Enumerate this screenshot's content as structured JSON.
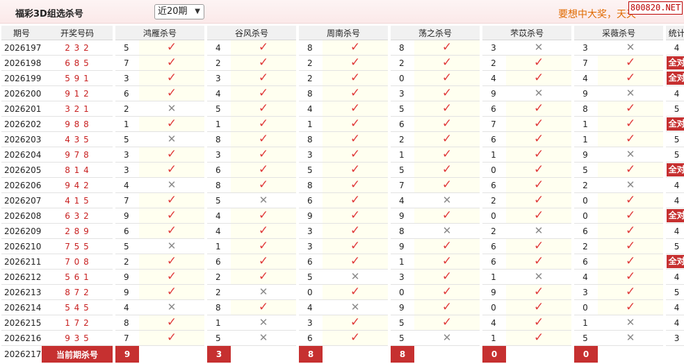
{
  "header": {
    "title": "福彩3D组选杀号",
    "period_select": "近20期",
    "slogan": "要想中大奖，天天",
    "watermark": "800820.NET"
  },
  "table": {
    "headers": {
      "issue": "期号",
      "draw": "开奖号码",
      "experts": [
        "鸿雁杀号",
        "谷风杀号",
        "周南杀号",
        "荡之杀号",
        "芣苡杀号",
        "采薇杀号"
      ],
      "stats": "统计"
    },
    "rows": [
      {
        "issue": "2026197",
        "draw": "2 3 2",
        "kills": [
          [
            5,
            1
          ],
          [
            4,
            1
          ],
          [
            8,
            1
          ],
          [
            8,
            1
          ],
          [
            3,
            0
          ],
          [
            3,
            0
          ]
        ],
        "stat": "4"
      },
      {
        "issue": "2026198",
        "draw": "6 8 5",
        "kills": [
          [
            7,
            1
          ],
          [
            2,
            1
          ],
          [
            2,
            1
          ],
          [
            2,
            1
          ],
          [
            2,
            1
          ],
          [
            7,
            1
          ]
        ],
        "stat": "全对"
      },
      {
        "issue": "2026199",
        "draw": "5 9 1",
        "kills": [
          [
            3,
            1
          ],
          [
            3,
            1
          ],
          [
            2,
            1
          ],
          [
            0,
            1
          ],
          [
            4,
            1
          ],
          [
            4,
            1
          ]
        ],
        "stat": "全对"
      },
      {
        "issue": "2026200",
        "draw": "9 1 2",
        "kills": [
          [
            6,
            1
          ],
          [
            4,
            1
          ],
          [
            8,
            1
          ],
          [
            3,
            1
          ],
          [
            9,
            0
          ],
          [
            9,
            0
          ]
        ],
        "stat": "4"
      },
      {
        "issue": "2026201",
        "draw": "3 2 1",
        "kills": [
          [
            2,
            0
          ],
          [
            5,
            1
          ],
          [
            4,
            1
          ],
          [
            5,
            1
          ],
          [
            6,
            1
          ],
          [
            8,
            1
          ]
        ],
        "stat": "5"
      },
      {
        "issue": "2026202",
        "draw": "9 8 8",
        "kills": [
          [
            1,
            1
          ],
          [
            1,
            1
          ],
          [
            1,
            1
          ],
          [
            6,
            1
          ],
          [
            7,
            1
          ],
          [
            1,
            1
          ]
        ],
        "stat": "全对"
      },
      {
        "issue": "2026203",
        "draw": "4 3 5",
        "kills": [
          [
            5,
            0
          ],
          [
            8,
            1
          ],
          [
            8,
            1
          ],
          [
            2,
            1
          ],
          [
            6,
            1
          ],
          [
            1,
            1
          ]
        ],
        "stat": "5"
      },
      {
        "issue": "2026204",
        "draw": "9 7 8",
        "kills": [
          [
            3,
            1
          ],
          [
            3,
            1
          ],
          [
            3,
            1
          ],
          [
            1,
            1
          ],
          [
            1,
            1
          ],
          [
            9,
            0
          ]
        ],
        "stat": "5"
      },
      {
        "issue": "2026205",
        "draw": "8 1 4",
        "kills": [
          [
            3,
            1
          ],
          [
            6,
            1
          ],
          [
            5,
            1
          ],
          [
            5,
            1
          ],
          [
            0,
            1
          ],
          [
            5,
            1
          ]
        ],
        "stat": "全对"
      },
      {
        "issue": "2026206",
        "draw": "9 4 2",
        "kills": [
          [
            4,
            0
          ],
          [
            8,
            1
          ],
          [
            8,
            1
          ],
          [
            7,
            1
          ],
          [
            6,
            1
          ],
          [
            2,
            0
          ]
        ],
        "stat": "4"
      },
      {
        "issue": "2026207",
        "draw": "4 1 5",
        "kills": [
          [
            7,
            1
          ],
          [
            5,
            0
          ],
          [
            6,
            1
          ],
          [
            4,
            0
          ],
          [
            2,
            1
          ],
          [
            0,
            1
          ]
        ],
        "stat": "4"
      },
      {
        "issue": "2026208",
        "draw": "6 3 2",
        "kills": [
          [
            9,
            1
          ],
          [
            4,
            1
          ],
          [
            9,
            1
          ],
          [
            9,
            1
          ],
          [
            0,
            1
          ],
          [
            0,
            1
          ]
        ],
        "stat": "全对"
      },
      {
        "issue": "2026209",
        "draw": "2 8 9",
        "kills": [
          [
            6,
            1
          ],
          [
            4,
            1
          ],
          [
            3,
            1
          ],
          [
            8,
            0
          ],
          [
            2,
            0
          ],
          [
            6,
            1
          ]
        ],
        "stat": "4"
      },
      {
        "issue": "2026210",
        "draw": "7 5 5",
        "kills": [
          [
            5,
            0
          ],
          [
            1,
            1
          ],
          [
            3,
            1
          ],
          [
            9,
            1
          ],
          [
            6,
            1
          ],
          [
            2,
            1
          ]
        ],
        "stat": "5"
      },
      {
        "issue": "2026211",
        "draw": "7 0 8",
        "kills": [
          [
            2,
            1
          ],
          [
            6,
            1
          ],
          [
            6,
            1
          ],
          [
            1,
            1
          ],
          [
            6,
            1
          ],
          [
            6,
            1
          ]
        ],
        "stat": "全对"
      },
      {
        "issue": "2026212",
        "draw": "5 6 1",
        "kills": [
          [
            9,
            1
          ],
          [
            2,
            1
          ],
          [
            5,
            0
          ],
          [
            3,
            1
          ],
          [
            1,
            0
          ],
          [
            4,
            1
          ]
        ],
        "stat": "4"
      },
      {
        "issue": "2026213",
        "draw": "8 7 2",
        "kills": [
          [
            9,
            1
          ],
          [
            2,
            0
          ],
          [
            0,
            1
          ],
          [
            0,
            1
          ],
          [
            9,
            1
          ],
          [
            3,
            1
          ]
        ],
        "stat": "5"
      },
      {
        "issue": "2026214",
        "draw": "5 4 5",
        "kills": [
          [
            4,
            0
          ],
          [
            8,
            1
          ],
          [
            4,
            0
          ],
          [
            9,
            1
          ],
          [
            0,
            1
          ],
          [
            0,
            1
          ]
        ],
        "stat": "4"
      },
      {
        "issue": "2026215",
        "draw": "1 7 2",
        "kills": [
          [
            8,
            1
          ],
          [
            1,
            0
          ],
          [
            3,
            1
          ],
          [
            5,
            1
          ],
          [
            4,
            1
          ],
          [
            1,
            0
          ]
        ],
        "stat": "4"
      },
      {
        "issue": "2026216",
        "draw": "9 3 5",
        "kills": [
          [
            7,
            1
          ],
          [
            5,
            0
          ],
          [
            6,
            1
          ],
          [
            5,
            0
          ],
          [
            1,
            1
          ],
          [
            5,
            0
          ]
        ],
        "stat": "3"
      }
    ],
    "current": {
      "issue": "2026217",
      "label": "当前期杀号",
      "kills": [
        "9",
        "3",
        "8",
        "8",
        "0",
        "0"
      ]
    }
  },
  "symbols": {
    "check": "✓",
    "cross": "✕"
  },
  "colors": {
    "accent_red": "#c63030",
    "check_red": "#e03a3a",
    "slogan_orange": "#e06a00"
  }
}
